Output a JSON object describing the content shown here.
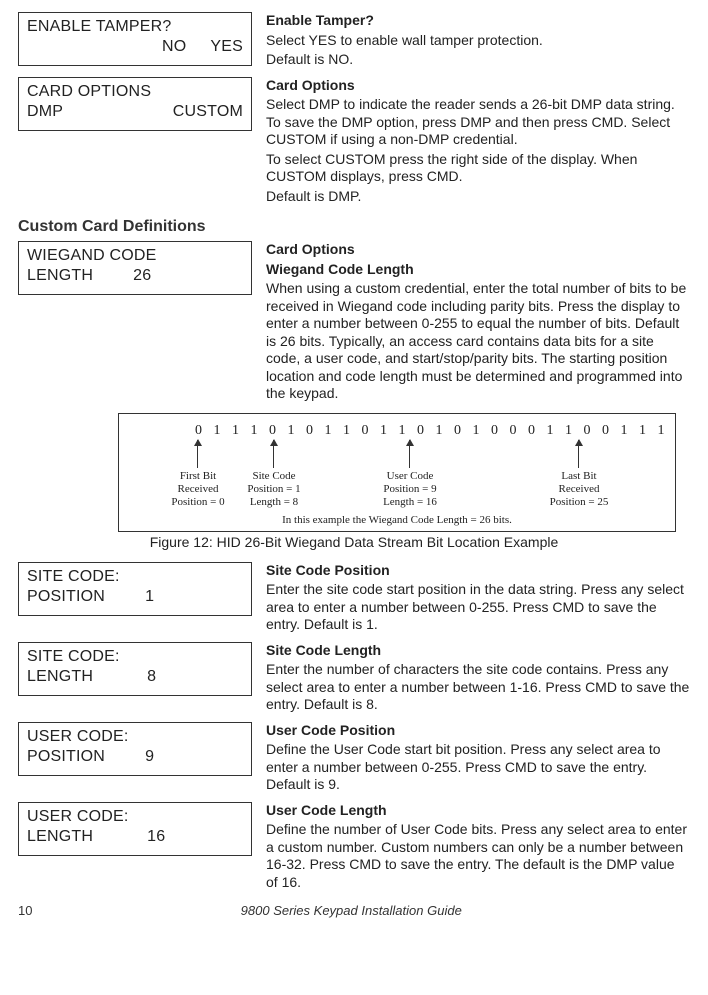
{
  "enable_tamper": {
    "box_line1": "ENABLE TAMPER?",
    "box_opt_no": "NO",
    "box_opt_yes": "YES",
    "title": "Enable Tamper?",
    "body1": "Select YES to enable wall tamper protection.",
    "body2": "Default is NO."
  },
  "card_options": {
    "box_line1": "CARD OPTIONS",
    "box_opt_dmp": "DMP",
    "box_opt_custom": "CUSTOM",
    "title": "Card Options",
    "body1": "Select DMP to indicate the reader sends a 26-bit DMP data string. To save the DMP option, press DMP and then press CMD. Select CUSTOM if using a non-DMP credential.",
    "body2": "To select CUSTOM press the right side of the display. When CUSTOM displays, press CMD.",
    "body3": "Default is DMP."
  },
  "custom_heading": "Custom Card Definitions",
  "wiegand": {
    "box_line1": "WIEGAND CODE",
    "box_label": "LENGTH",
    "box_value": "26",
    "title": "Card Options",
    "subtitle": "Wiegand Code Length",
    "body": "When using a custom credential, enter the total number of bits to be received in Wiegand code including parity bits. Press the display to enter a number between 0-255 to equal the number of bits. Default is 26 bits. Typically, an access card contains data bits for a site code, a user code, and start/stop/parity bits. The starting position location and code length must be determined and programmed into the keypad."
  },
  "figure": {
    "bitstream": "0 1 1 1 0 1 0 1 1 0 1 1 0 1 0 1 0 0 0 1 1 0 0 1 1 1",
    "lbl1a": "First Bit",
    "lbl1b": "Received",
    "lbl1c": "Position = 0",
    "lbl2a": "Site Code",
    "lbl2b": "Position = 1",
    "lbl2c": "Length = 8",
    "lbl3a": "User Code",
    "lbl3b": "Position = 9",
    "lbl3c": "Length = 16",
    "lbl4a": "Last Bit",
    "lbl4b": "Received",
    "lbl4c": "Position = 25",
    "caption": "In this example the Wiegand Code Length = 26 bits.",
    "title": "Figure 12: HID 26-Bit Wiegand Data Stream Bit Location Example"
  },
  "site_code_position": {
    "box_line1": "SITE CODE:",
    "box_label": "POSITION",
    "box_value": "1",
    "title": "Site Code Position",
    "body": "Enter the site code start position in the data string. Press any select area to enter a number between 0-255. Press CMD to save the entry. Default is 1."
  },
  "site_code_length": {
    "box_line1": "SITE CODE:",
    "box_label": "LENGTH",
    "box_value": "8",
    "title": "Site Code Length",
    "body": "Enter the number of characters the site code contains. Press any select area to enter a number between 1-16. Press CMD to save the entry. Default is 8."
  },
  "user_code_position": {
    "box_line1": "USER CODE:",
    "box_label": "POSITION",
    "box_value": "9",
    "title": "User Code Position",
    "body": "Define the User Code start bit position. Press any select area to enter a number between 0-255. Press CMD to save the entry. Default is 9."
  },
  "user_code_length": {
    "box_line1": "USER CODE:",
    "box_label": "LENGTH",
    "box_value": "16",
    "title": "User Code Length",
    "body": "Define the number of User Code bits. Press any select area to enter a custom number. Custom numbers can only be a number between 16-32. Press CMD to save the entry. The default is the DMP value of 16."
  },
  "footer": {
    "page": "10",
    "doc": "9800 Series Keypad Installation Guide"
  }
}
